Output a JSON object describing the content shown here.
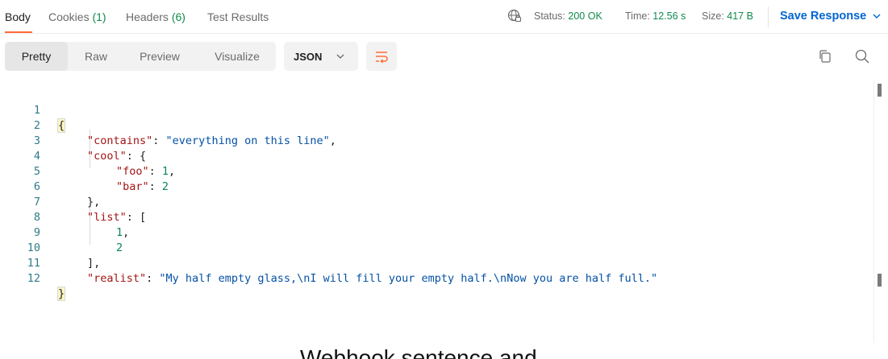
{
  "tabs": [
    {
      "label": "Body",
      "count": ""
    },
    {
      "label": "Cookies",
      "count": "(1)"
    },
    {
      "label": "Headers",
      "count": "(6)"
    },
    {
      "label": "Test Results",
      "count": ""
    }
  ],
  "status": {
    "status_label": "Status:",
    "status_value": "200 OK",
    "time_label": "Time:",
    "time_value": "12.56 s",
    "size_label": "Size:",
    "size_value": "417 B"
  },
  "save_response_label": "Save Response",
  "view_modes": [
    "Pretty",
    "Raw",
    "Preview",
    "Visualize"
  ],
  "format_select": "JSON",
  "code_lines": [
    {
      "num": "1"
    },
    {
      "num": "2",
      "key": "\"contains\"",
      "value": "\"everything on this line\""
    },
    {
      "num": "3",
      "key": "\"cool\""
    },
    {
      "num": "4",
      "key": "\"foo\"",
      "value": "1"
    },
    {
      "num": "5",
      "key": "\"bar\"",
      "value": "2"
    },
    {
      "num": "6"
    },
    {
      "num": "7",
      "key": "\"list\""
    },
    {
      "num": "8",
      "value": "1"
    },
    {
      "num": "9",
      "value": "2"
    },
    {
      "num": "10"
    },
    {
      "num": "11",
      "key": "\"realist\"",
      "value": "\"My half empty glass,\\nI will fill your empty half.\\nNow you are half full.\""
    },
    {
      "num": "12"
    }
  ],
  "caption": "Webhook sentence and",
  "colors": {
    "accent": "#ff6c37",
    "success": "#0f8a4d",
    "link": "#0265d2"
  }
}
